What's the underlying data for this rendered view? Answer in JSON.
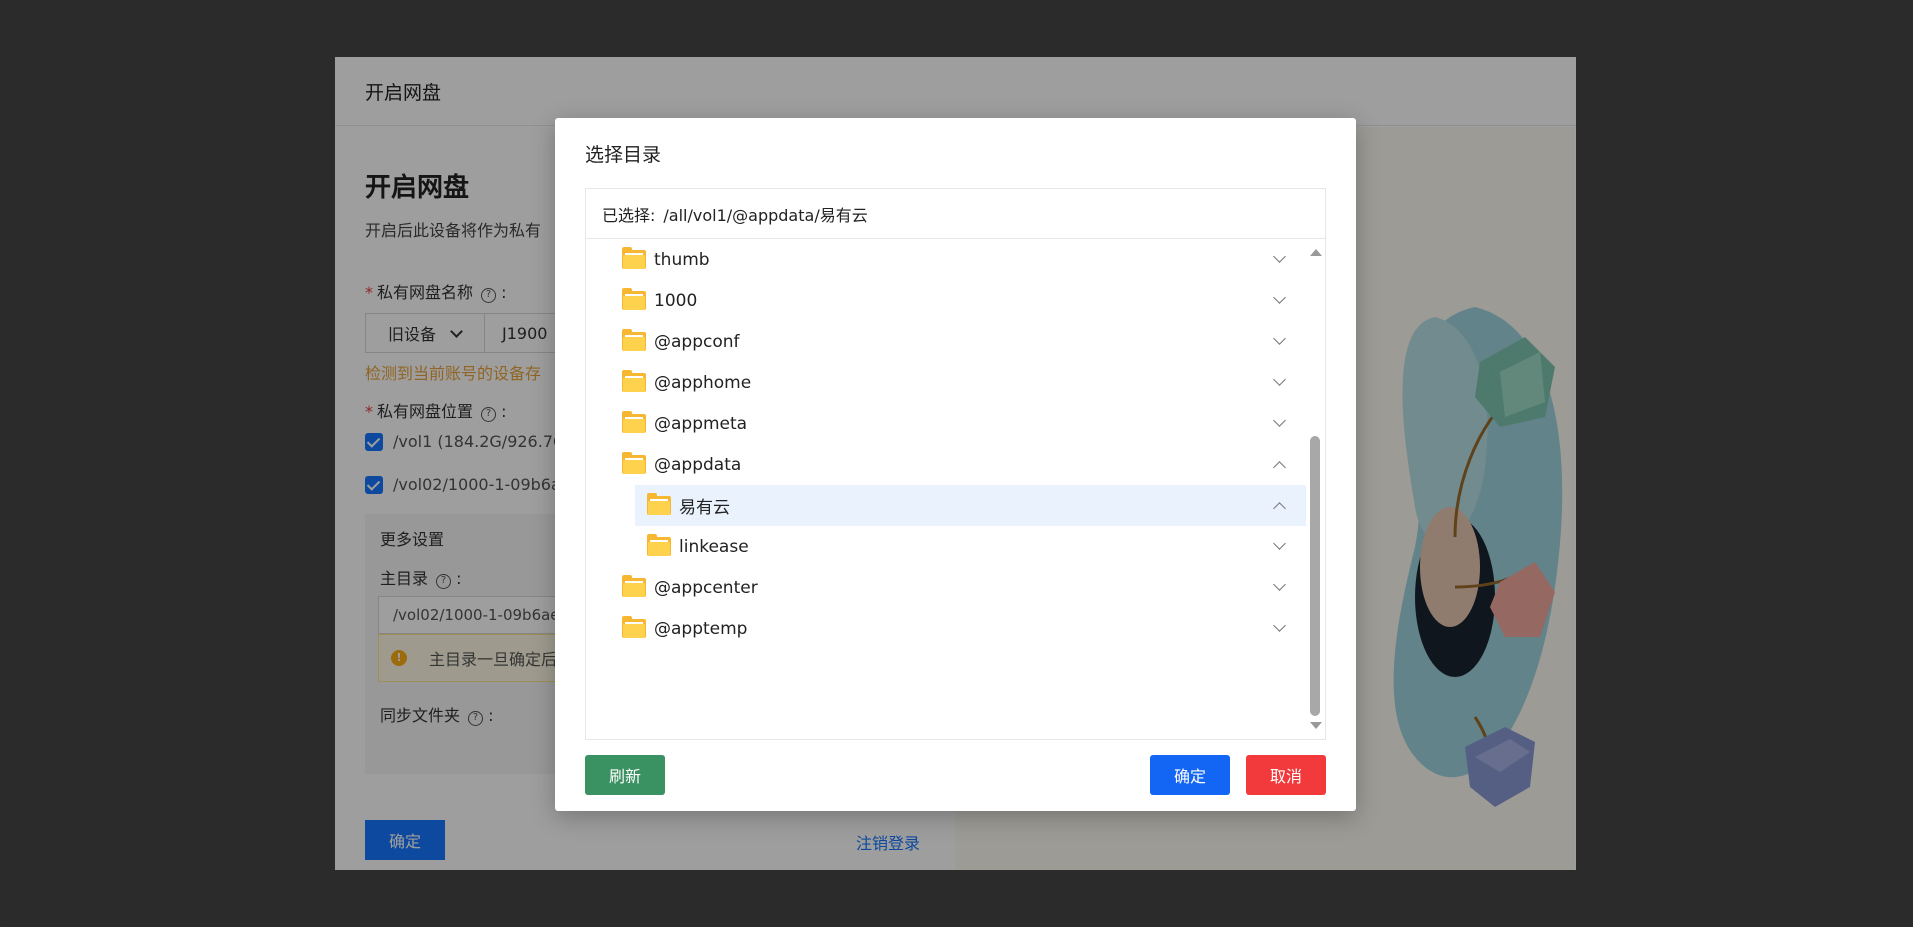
{
  "page": {
    "header_title": "开启网盘",
    "title": "开启网盘",
    "description": "开启后此设备将作为私有",
    "name_label": "私有网盘名称",
    "name_select_value": "旧设备",
    "name_input_value": "J1900",
    "warning_text": "检测到当前账号的设备存",
    "location_label": "私有网盘位置",
    "volumes": [
      "/vol1 (184.2G/926.7G",
      "/vol02/1000-1-09b6a"
    ],
    "more_settings": {
      "title": "更多设置",
      "home_dir_label": "主目录",
      "home_dir_value": "/vol02/1000-1-09b6ae",
      "alert_text": "主目录一旦确定后",
      "sync_label": "同步文件夹"
    },
    "confirm_label": "确定",
    "logout_label": "注销登录"
  },
  "modal": {
    "title": "选择目录",
    "selected_prefix": "已选择:",
    "selected_path": "/all/vol1/@appdata/易有云",
    "tree": [
      {
        "name": "thumb",
        "level": 0,
        "expanded": false,
        "active": false
      },
      {
        "name": "1000",
        "level": 0,
        "expanded": false,
        "active": false
      },
      {
        "name": "@appconf",
        "level": 0,
        "expanded": false,
        "active": false
      },
      {
        "name": "@apphome",
        "level": 0,
        "expanded": false,
        "active": false
      },
      {
        "name": "@appmeta",
        "level": 0,
        "expanded": false,
        "active": false
      },
      {
        "name": "@appdata",
        "level": 0,
        "expanded": true,
        "active": false
      },
      {
        "name": "易有云",
        "level": 1,
        "expanded": true,
        "active": true
      },
      {
        "name": "linkease",
        "level": 1,
        "expanded": false,
        "active": false
      },
      {
        "name": "@appcenter",
        "level": 0,
        "expanded": false,
        "active": false
      },
      {
        "name": "@apptemp",
        "level": 0,
        "expanded": false,
        "active": false
      }
    ],
    "refresh_label": "刷新",
    "ok_label": "确定",
    "cancel_label": "取消"
  },
  "colors": {
    "primary": "#1365f3",
    "success": "#3a9162",
    "danger": "#f23a3c",
    "folder": "#f7b731",
    "active_row": "#eaf2fd"
  },
  "icons": {
    "folder": "folder-icon",
    "expand": "chevron-down-icon",
    "collapse": "chevron-up-icon",
    "help": "question-circle-icon",
    "info": "info-circle-icon"
  }
}
